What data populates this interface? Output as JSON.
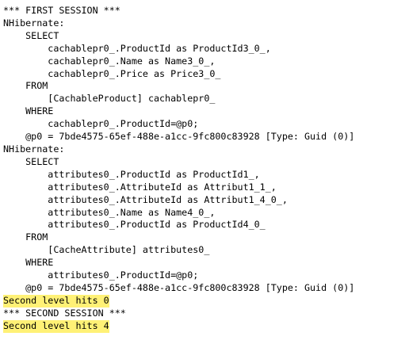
{
  "console": {
    "lines": [
      {
        "text": "*** FIRST SESSION ***",
        "highlight": false
      },
      {
        "text": "NHibernate:",
        "highlight": false
      },
      {
        "text": "    SELECT",
        "highlight": false
      },
      {
        "text": "        cachablepr0_.ProductId as ProductId3_0_,",
        "highlight": false
      },
      {
        "text": "        cachablepr0_.Name as Name3_0_,",
        "highlight": false
      },
      {
        "text": "        cachablepr0_.Price as Price3_0_",
        "highlight": false
      },
      {
        "text": "    FROM",
        "highlight": false
      },
      {
        "text": "        [CachableProduct] cachablepr0_",
        "highlight": false
      },
      {
        "text": "    WHERE",
        "highlight": false
      },
      {
        "text": "        cachablepr0_.ProductId=@p0;",
        "highlight": false
      },
      {
        "text": "    @p0 = 7bde4575-65ef-488e-a1cc-9fc800c83928 [Type: Guid (0)]",
        "highlight": false
      },
      {
        "text": "NHibernate:",
        "highlight": false
      },
      {
        "text": "    SELECT",
        "highlight": false
      },
      {
        "text": "        attributes0_.ProductId as ProductId1_,",
        "highlight": false
      },
      {
        "text": "        attributes0_.AttributeId as Attribut1_1_,",
        "highlight": false
      },
      {
        "text": "        attributes0_.AttributeId as Attribut1_4_0_,",
        "highlight": false
      },
      {
        "text": "        attributes0_.Name as Name4_0_,",
        "highlight": false
      },
      {
        "text": "        attributes0_.ProductId as ProductId4_0_",
        "highlight": false
      },
      {
        "text": "    FROM",
        "highlight": false
      },
      {
        "text": "        [CacheAttribute] attributes0_",
        "highlight": false
      },
      {
        "text": "    WHERE",
        "highlight": false
      },
      {
        "text": "        attributes0_.ProductId=@p0;",
        "highlight": false
      },
      {
        "text": "    @p0 = 7bde4575-65ef-488e-a1cc-9fc800c83928 [Type: Guid (0)]",
        "highlight": false
      },
      {
        "text": "Second level hits 0",
        "highlight": true
      },
      {
        "text": "*** SECOND SESSION ***",
        "highlight": false
      },
      {
        "text": "Second level hits 4",
        "highlight": true
      }
    ],
    "highlight_color": "#fff176"
  }
}
